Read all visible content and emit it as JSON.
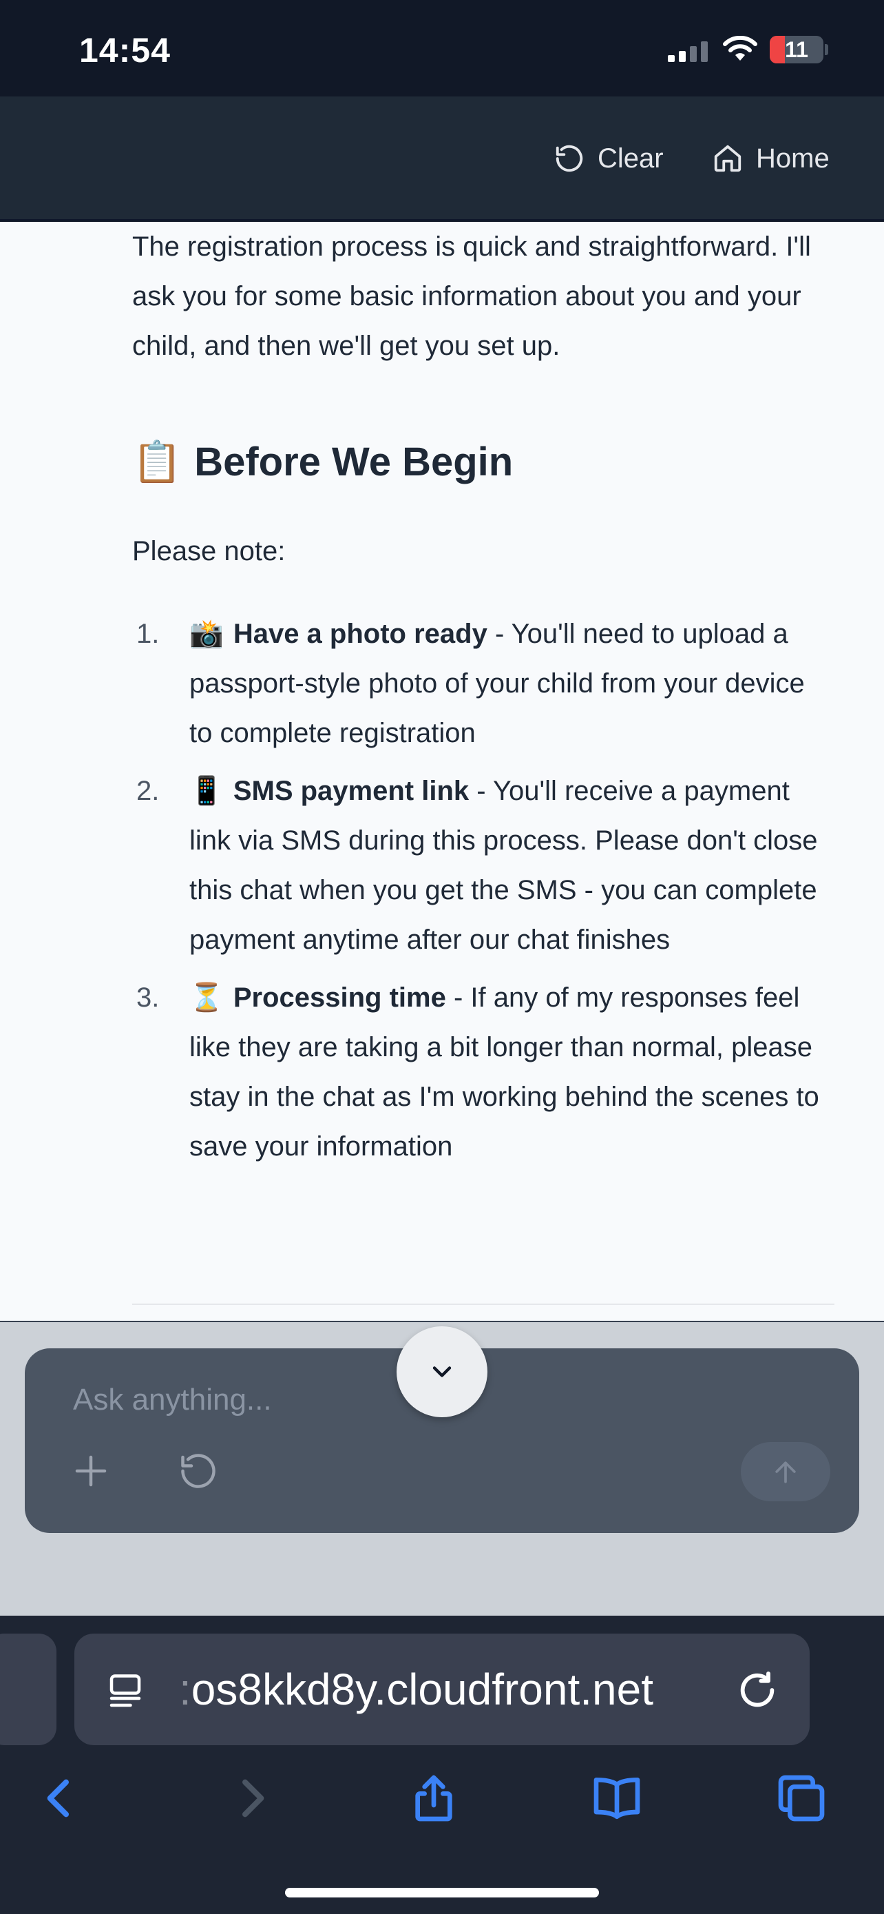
{
  "status_bar": {
    "time": "14:54",
    "battery": "11"
  },
  "header": {
    "clear_label": "Clear",
    "home_label": "Home"
  },
  "content": {
    "intro": "The registration process is quick and straightforward. I'll ask you for some basic information about you and your child, and then we'll get you set up.",
    "section_emoji": "📋",
    "section_title": "Before We Begin",
    "note": "Please note:",
    "items": [
      {
        "number": "1.",
        "emoji": "📸",
        "title": "Have a photo ready",
        "text": " - You'll need to upload a passport-style photo of your child from your device to complete registration"
      },
      {
        "number": "2.",
        "emoji": "📱",
        "title": "SMS payment link",
        "text": " - You'll receive a payment link via SMS during this process. Please don't close this chat when you get the SMS - you can complete payment anytime after our chat finishes"
      },
      {
        "number": "3.",
        "emoji": "⏳",
        "title": "Processing time",
        "text": " - If any of my responses feel like they are taking a bit longer than normal, please stay in the chat as I'm working behind the scenes to save your information"
      }
    ]
  },
  "composer": {
    "placeholder": "Ask anything..."
  },
  "browser": {
    "url_prefix": ":",
    "url": "os8kkd8y.cloudfront.net"
  },
  "icons": {
    "clear": "rotate-ccw-icon",
    "home": "home-icon",
    "scroll_down": "chevron-down-icon",
    "plus": "plus-icon",
    "reset": "rotate-ccw-icon",
    "send": "arrow-up-icon",
    "reader": "reader-mode-icon",
    "reload": "reload-icon",
    "back": "chevron-left-icon",
    "forward": "chevron-right-icon",
    "share": "share-icon",
    "bookmarks": "book-icon",
    "tabs": "tabs-icon"
  },
  "colors": {
    "accent": "#3b82f6",
    "header_bg": "#1f2a37",
    "content_bg": "#f8fafc",
    "composer_bg": "#4b5563"
  }
}
